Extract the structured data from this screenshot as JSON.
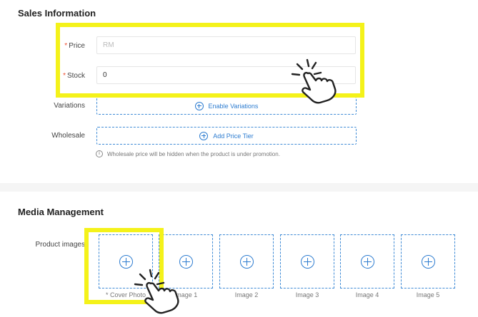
{
  "sales": {
    "title": "Sales Information",
    "required_mark": "*",
    "price": {
      "label": "Price",
      "placeholder": "RM",
      "value": ""
    },
    "stock": {
      "label": "Stock",
      "value": "0"
    },
    "variations": {
      "label": "Variations",
      "button": "Enable Variations"
    },
    "wholesale": {
      "label": "Wholesale",
      "button": "Add Price Tier"
    },
    "note_icon": "i",
    "note": "Wholesale price will be hidden when the product is under promotion."
  },
  "media": {
    "title": "Media Management",
    "product_images_label": "Product images",
    "slots": [
      {
        "label": "* Cover Photo"
      },
      {
        "label": "Image 1"
      },
      {
        "label": "Image 2"
      },
      {
        "label": "Image 3"
      },
      {
        "label": "Image 4"
      },
      {
        "label": "Image 5"
      }
    ]
  },
  "colors": {
    "highlight": "#f4f21a",
    "accent": "#2d7cd0",
    "required": "#ee4d2d"
  },
  "icons": [
    "plus-circle-icon",
    "info-icon",
    "hand-pointer-icon"
  ]
}
